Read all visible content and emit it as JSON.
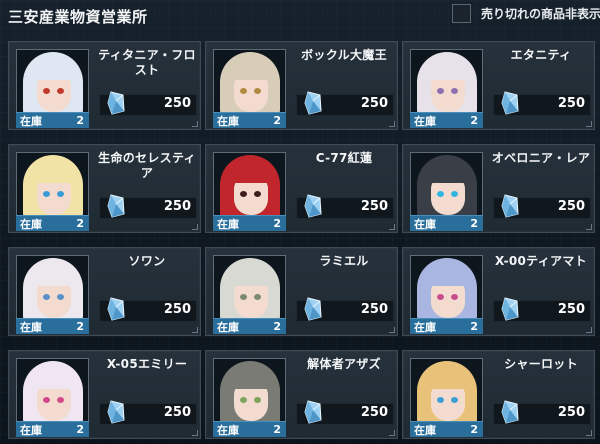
{
  "shop": {
    "title": "三安産業物資営業所",
    "hide_sold_out_label": "売り切れの商品非表示"
  },
  "currency_icon": "crystal-icon",
  "stock_label": "在庫",
  "items": [
    {
      "name": "ティタニア・フロスト",
      "price": "250",
      "stock": "2",
      "hair": "#dfe8f2",
      "eye": "#c0392b"
    },
    {
      "name": "ボックル大魔王",
      "price": "250",
      "stock": "2",
      "hair": "#d8cdb8",
      "eye": "#b08a3e"
    },
    {
      "name": "エタニティ",
      "price": "250",
      "stock": "2",
      "hair": "#e7e2ea",
      "eye": "#8e6fb0"
    },
    {
      "name": "生命のセレスティア",
      "price": "250",
      "stock": "2",
      "hair": "#f1e3a6",
      "eye": "#3a9bd6"
    },
    {
      "name": "C-77紅蓮",
      "price": "250",
      "stock": "2",
      "hair": "#c0262b",
      "eye": "#3c1c1c"
    },
    {
      "name": "オベロニア・レア",
      "price": "250",
      "stock": "2",
      "hair": "#3a3f47",
      "eye": "#2fb6e0"
    },
    {
      "name": "ソワン",
      "price": "250",
      "stock": "2",
      "hair": "#ece8ee",
      "eye": "#5a8fc7"
    },
    {
      "name": "ラミエル",
      "price": "250",
      "stock": "2",
      "hair": "#d9d9d4",
      "eye": "#7c8a6d"
    },
    {
      "name": "X-00ティアマト",
      "price": "250",
      "stock": "2",
      "hair": "#aab6e2",
      "eye": "#c84d8f"
    },
    {
      "name": "X-05エミリー",
      "price": "250",
      "stock": "2",
      "hair": "#efe6f2",
      "eye": "#d04a8a"
    },
    {
      "name": "解体者アザズ",
      "price": "250",
      "stock": "2",
      "hair": "#7b7b76",
      "eye": "#7da35d"
    },
    {
      "name": "シャーロット",
      "price": "250",
      "stock": "2",
      "hair": "#e9c27a",
      "eye": "#3b9fd5"
    }
  ]
}
